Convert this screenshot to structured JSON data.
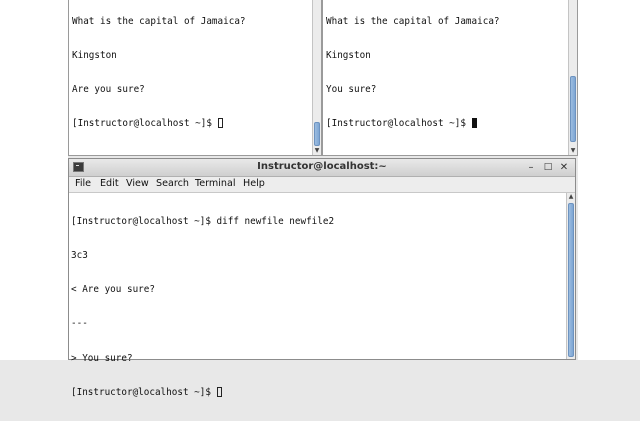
{
  "top_left_terminal": {
    "lines": [
      "What is the capital of Jamaica?",
      "Kingston",
      "Are you sure?"
    ],
    "prompt": "[Instructor@localhost ~]$ "
  },
  "top_right_terminal": {
    "lines": [
      "What is the capital of Jamaica?",
      "Kingston",
      "You sure?"
    ],
    "prompt": "[Instructor@localhost ~]$ "
  },
  "main_window": {
    "title": "Instructor@localhost:~",
    "menu": [
      "File",
      "Edit",
      "View",
      "Search",
      "Terminal",
      "Help"
    ],
    "output": [
      "[Instructor@localhost ~]$ diff newfile newfile2",
      "3c3",
      "< Are you sure?",
      "---",
      "> You sure?"
    ],
    "prompt": "[Instructor@localhost ~]$ ",
    "buttons": {
      "minimize": "–",
      "maximize": "□",
      "close": "✕"
    }
  },
  "icons": {
    "app": "terminal-icon",
    "scroll_up": "▲",
    "scroll_down": "▼"
  }
}
